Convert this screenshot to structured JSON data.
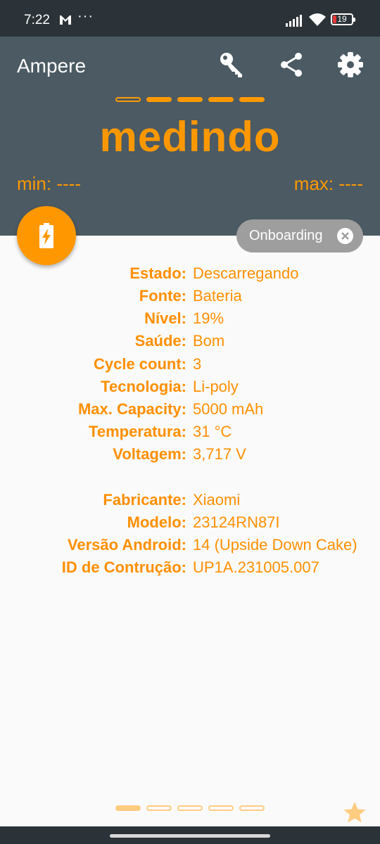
{
  "status_bar": {
    "time": "7:22",
    "more": "···",
    "battery_level": "19"
  },
  "app": {
    "title": "Ampere",
    "measuring_text": "medindo",
    "min_text": "min: ----",
    "max_text": "max: ----",
    "accent_color": "#ff9800",
    "header_color": "#4b5a63"
  },
  "header_icons": [
    "key-icon",
    "share-icon",
    "gear-icon"
  ],
  "chip": {
    "label": "Onboarding"
  },
  "battery_info": [
    {
      "label": "Estado:",
      "value": "Descarregando"
    },
    {
      "label": "Fonte:",
      "value": "Bateria"
    },
    {
      "label": "Nível:",
      "value": "19%"
    },
    {
      "label": "Saúde:",
      "value": "Bom"
    },
    {
      "label": "Cycle count:",
      "value": "3"
    },
    {
      "label": "Tecnologia:",
      "value": "Li-poly"
    },
    {
      "label": "Max. Capacity:",
      "value": "5000 mAh"
    },
    {
      "label": "Temperatura:",
      "value": "31 °C"
    },
    {
      "label": "Voltagem:",
      "value": "3,717 V"
    }
  ],
  "device_info": [
    {
      "label": "Fabricante:",
      "value": "Xiaomi"
    },
    {
      "label": "Modelo:",
      "value": "23124RN87I"
    },
    {
      "label": "Versão Android:",
      "value": "14 (Upside Down Cake)"
    },
    {
      "label": "ID de Contrução:",
      "value": "UP1A.231005.007"
    }
  ],
  "pager": {
    "total_pages": 5,
    "current_page": 1
  }
}
